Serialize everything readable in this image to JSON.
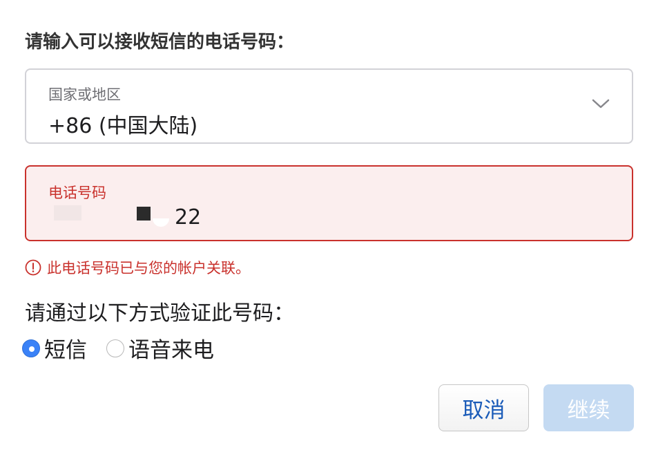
{
  "prompt": "请输入可以接收短信的电话号码：",
  "country": {
    "label": "国家或地区",
    "value": "+86 (中国大陆)"
  },
  "phone": {
    "label": "电话号码",
    "value_visible": "22"
  },
  "error_text": "此电话号码已与您的帐户关联。",
  "verify": {
    "label": "请通过以下方式验证此号码：",
    "options": [
      "短信",
      "语音来电"
    ],
    "selected": "短信"
  },
  "buttons": {
    "cancel": "取消",
    "continue": "继续"
  },
  "colors": {
    "error": "#c9312c",
    "accent": "#3a82f7",
    "link": "#1a5bb8",
    "disabled_button": "#c4daf2"
  },
  "icons": {
    "chevron": "chevron-down-icon",
    "error": "exclamation-circle-icon"
  }
}
